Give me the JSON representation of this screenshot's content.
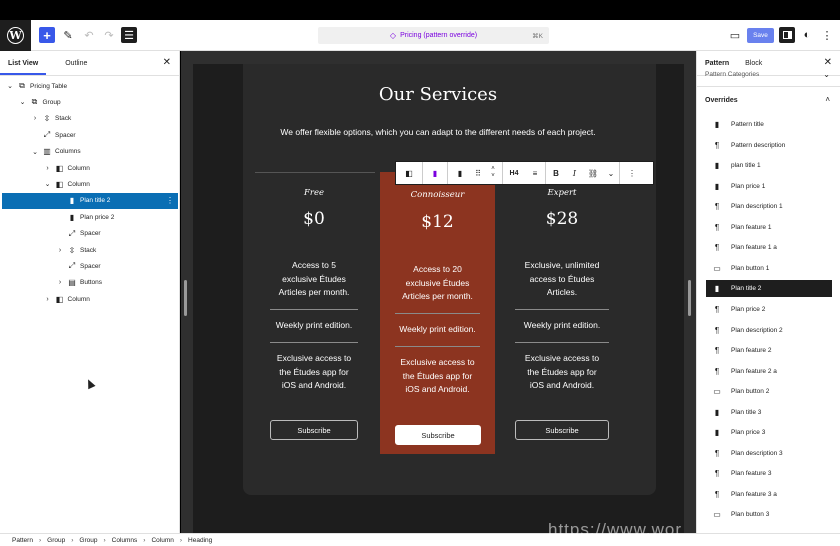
{
  "toolbar": {
    "logo": "W",
    "add_icon": "+",
    "document_title": "Pricing (pattern override)",
    "shortcut": "⌘K",
    "save_label": "Save"
  },
  "left_panel": {
    "tabs": [
      "List View",
      "Outline"
    ],
    "tree": [
      {
        "label": "Pricing Table",
        "icon": "⧉",
        "chev": "⌄",
        "depth": 0
      },
      {
        "label": "Group",
        "icon": "⧉",
        "chev": "⌄",
        "depth": 1
      },
      {
        "label": "Stack",
        "icon": "⇳",
        "chev": "›",
        "depth": 2
      },
      {
        "label": "Spacer",
        "icon": "⤢",
        "chev": "",
        "depth": 2
      },
      {
        "label": "Columns",
        "icon": "▥",
        "chev": "⌄",
        "depth": 2
      },
      {
        "label": "Column",
        "icon": "◧",
        "chev": "›",
        "depth": 3
      },
      {
        "label": "Column",
        "icon": "◧",
        "chev": "⌄",
        "depth": 3
      },
      {
        "label": "Plan title 2",
        "icon": "▮",
        "chev": "",
        "depth": 4,
        "selected": true
      },
      {
        "label": "Plan price 2",
        "icon": "▮",
        "chev": "",
        "depth": 4
      },
      {
        "label": "Spacer",
        "icon": "⤢",
        "chev": "",
        "depth": 4
      },
      {
        "label": "Stack",
        "icon": "⇳",
        "chev": "›",
        "depth": 4
      },
      {
        "label": "Spacer",
        "icon": "⤢",
        "chev": "",
        "depth": 4
      },
      {
        "label": "Buttons",
        "icon": "▤",
        "chev": "›",
        "depth": 4
      },
      {
        "label": "Column",
        "icon": "◧",
        "chev": "›",
        "depth": 3
      }
    ]
  },
  "canvas": {
    "title": "Our Services",
    "description": "We offer flexible options, which you can adapt to the different needs of each project.",
    "plans": [
      {
        "title": "Free",
        "price": "$0",
        "desc": [
          "Access to 5",
          "exclusive Études",
          "Articles per month."
        ],
        "feature1": "Weekly print edition.",
        "feature2": [
          "Exclusive access to",
          "the Études app for",
          "iOS and Android."
        ],
        "button": "Subscribe"
      },
      {
        "title": "Connoisseur",
        "price": "$12",
        "desc": [
          "Access to 20",
          "exclusive Études",
          "Articles per month."
        ],
        "feature1": "Weekly print edition.",
        "feature2": [
          "Exclusive access to",
          "the Études app for",
          "iOS and Android."
        ],
        "button": "Subscribe"
      },
      {
        "title": "Expert",
        "price": "$28",
        "desc": [
          "Exclusive, unlimited",
          "access to Études",
          "Articles."
        ],
        "feature1": "Weekly print edition.",
        "feature2": [
          "Exclusive access to",
          "the Études app for",
          "iOS and Android."
        ],
        "button": "Subscribe"
      }
    ],
    "block_toolbar": {
      "heading_level": "H4"
    }
  },
  "right_panel": {
    "tabs": [
      "Pattern",
      "Block"
    ],
    "categories_label": "Pattern Categories",
    "overrides_label": "Overrides",
    "overrides": [
      {
        "label": "Pattern title",
        "icon": "▮"
      },
      {
        "label": "Pattern description",
        "icon": "¶"
      },
      {
        "label": "plan title 1",
        "icon": "▮"
      },
      {
        "label": "Plan price 1",
        "icon": "▮"
      },
      {
        "label": "Plan description 1",
        "icon": "¶"
      },
      {
        "label": "Plan feature 1",
        "icon": "¶"
      },
      {
        "label": "Plan feature 1 a",
        "icon": "¶"
      },
      {
        "label": "Plan button 1",
        "icon": "▭"
      },
      {
        "label": "Plan title 2",
        "icon": "▮",
        "selected": true
      },
      {
        "label": "Plan price 2",
        "icon": "¶"
      },
      {
        "label": "Plan description 2",
        "icon": "¶"
      },
      {
        "label": "Plan feature 2",
        "icon": "¶"
      },
      {
        "label": "Plan feature 2 a",
        "icon": "¶"
      },
      {
        "label": "Plan button 2",
        "icon": "▭"
      },
      {
        "label": "Plan title 3",
        "icon": "▮"
      },
      {
        "label": "Plan price 3",
        "icon": "▮"
      },
      {
        "label": "Plan description 3",
        "icon": "¶"
      },
      {
        "label": "Plan feature 3",
        "icon": "¶"
      },
      {
        "label": "Plan feature 3 a",
        "icon": "¶"
      },
      {
        "label": "Plan button 3",
        "icon": "▭"
      }
    ]
  },
  "breadcrumb": [
    "Pattern",
    "Group",
    "Group",
    "Columns",
    "Column",
    "Heading"
  ],
  "watermark": "https://www.wor",
  "colors": {
    "accent": "#3858e9",
    "featured": "#8c3420",
    "selection": "#0a6eb4"
  }
}
